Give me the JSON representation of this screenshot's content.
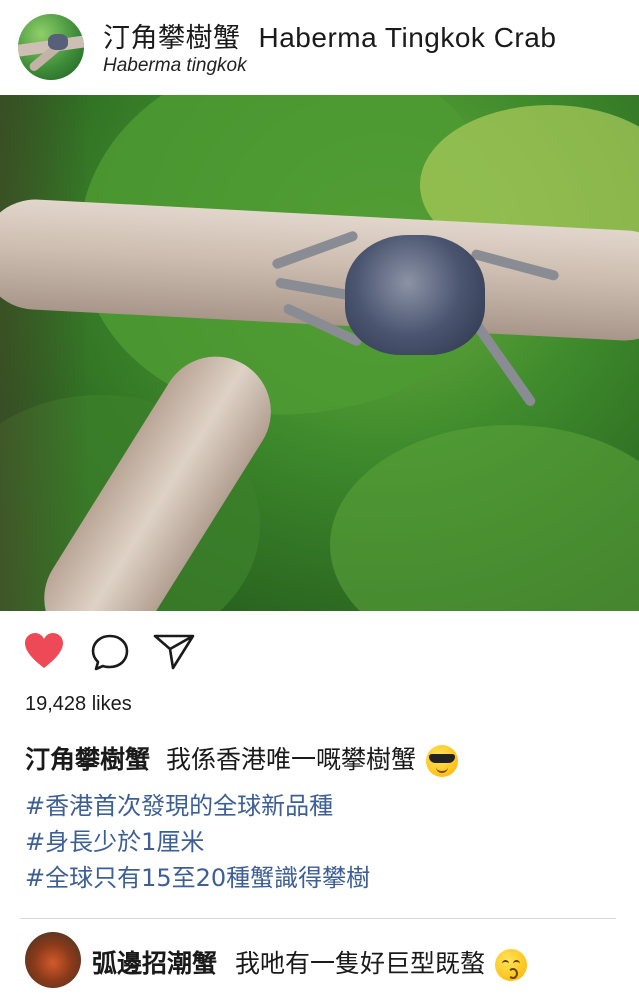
{
  "header": {
    "username_zh": "汀角攀樹蟹",
    "username_en": "Haberma Tingkok Crab",
    "subtitle": "Haberma tingkok"
  },
  "post": {
    "image_icon": "crab-on-branch-photo"
  },
  "actions": {
    "like_icon": "heart-icon",
    "comment_icon": "speech-bubble-icon",
    "share_icon": "paper-plane-icon",
    "like_color": "#ed4956"
  },
  "likes_text": "19,428 likes",
  "caption": {
    "user": "汀角攀樹蟹",
    "text": "我係香港唯一嘅攀樹蟹",
    "emoji": "sunglasses-emoji"
  },
  "hashtags": [
    "#香港首次發現的全球新品種",
    "#身長少於1厘米",
    "#全球只有15至20種蟹識得攀樹"
  ],
  "comment": {
    "user": "弧邊招潮蟹",
    "text": "我吔有一隻好巨型既螯",
    "emoji": "kissing-emoji"
  },
  "colors": {
    "hashtag": "#3d5f95",
    "text": "#1a1a1a"
  }
}
